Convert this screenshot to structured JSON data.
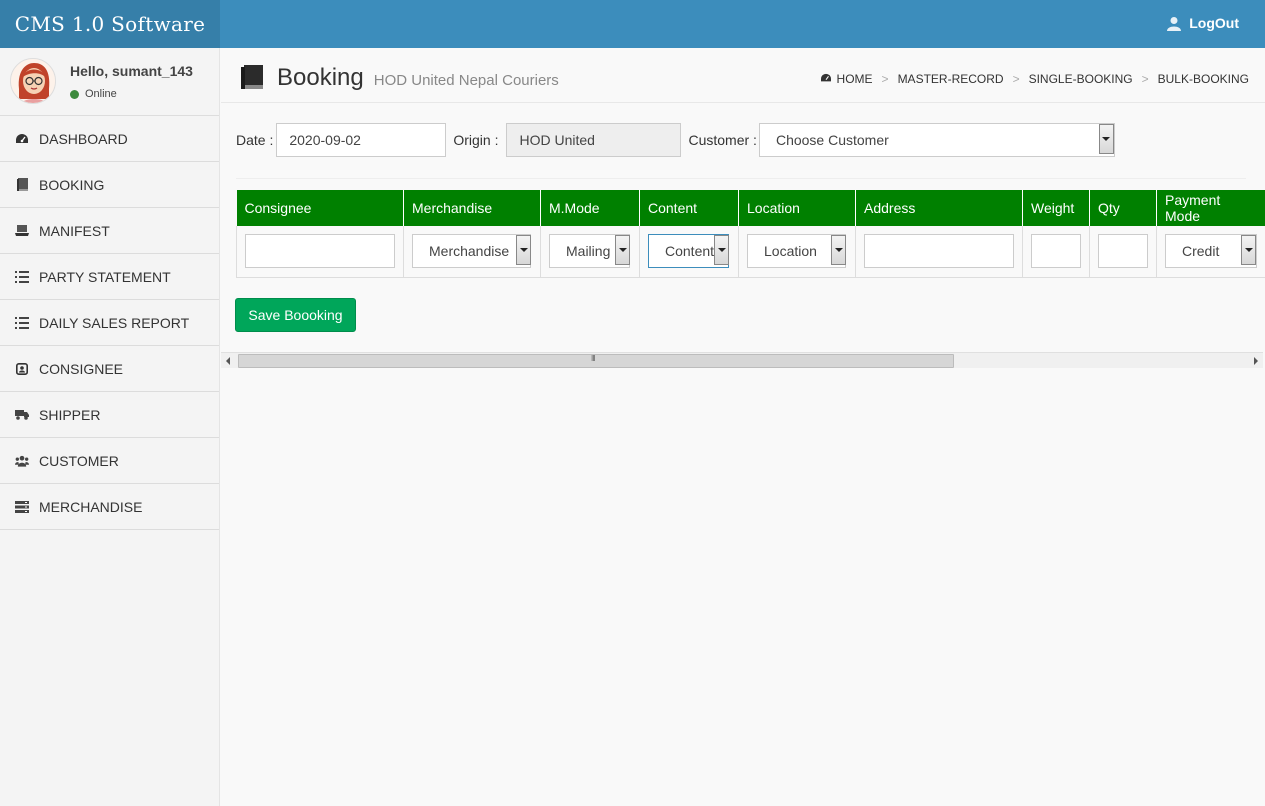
{
  "app": {
    "title": "CMS 1.0 Software",
    "logout_label": "LogOut"
  },
  "user": {
    "greeting": "Hello, sumant_143",
    "status": "Online"
  },
  "sidebar": {
    "items": [
      {
        "label": "DASHBOARD",
        "icon": "dashboard-icon"
      },
      {
        "label": "BOOKING",
        "icon": "book-icon"
      },
      {
        "label": "MANIFEST",
        "icon": "laptop-icon"
      },
      {
        "label": "PARTY STATEMENT",
        "icon": "list-icon"
      },
      {
        "label": "DAILY SALES REPORT",
        "icon": "list-icon"
      },
      {
        "label": "CONSIGNEE",
        "icon": "user-square-icon"
      },
      {
        "label": "SHIPPER",
        "icon": "truck-icon"
      },
      {
        "label": "CUSTOMER",
        "icon": "users-icon"
      },
      {
        "label": "MERCHANDISE",
        "icon": "server-icon"
      }
    ]
  },
  "page": {
    "title": "Booking",
    "subtitle": "HOD United Nepal Couriers"
  },
  "breadcrumb": {
    "home": "HOME",
    "master": "MASTER-RECORD",
    "single": "SINGLE-BOOKING",
    "bulk": "BULK-BOOKING",
    "separator": ">"
  },
  "form": {
    "date_label": "Date :",
    "date_value": "2020-09-02",
    "origin_label": "Origin :",
    "origin_value": "HOD United",
    "customer_label": "Customer :",
    "customer_value": "Choose Customer"
  },
  "table": {
    "headers": [
      "Consignee",
      "Merchandise",
      "M.Mode",
      "Content",
      "Location",
      "Address",
      "Weight",
      "Qty",
      "Payment Mode"
    ],
    "row": {
      "consignee": "",
      "merchandise": "Merchandise",
      "mmode": "Mailing",
      "content": "Content",
      "location": "Location",
      "address": "",
      "weight": "",
      "qty": "",
      "payment": "Credit"
    }
  },
  "actions": {
    "save_label": "Save Boooking"
  },
  "colors": {
    "header_bg": "#3c8dbc",
    "logo_bg": "#367fa9",
    "table_header": "#008000",
    "save_button": "#00a65a",
    "online": "#3d8b3d"
  }
}
